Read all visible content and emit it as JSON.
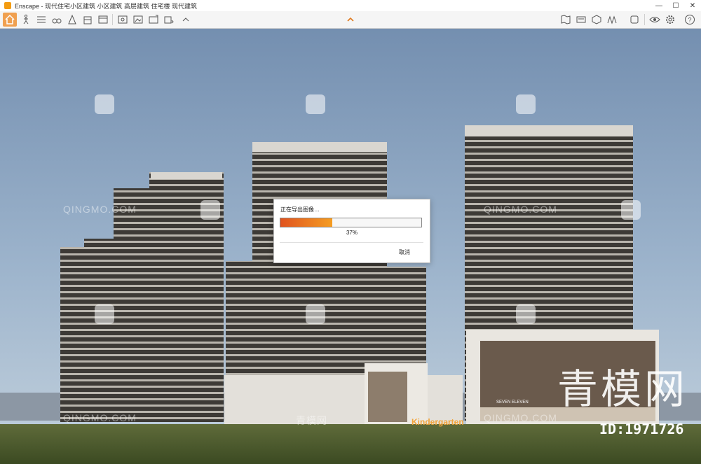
{
  "window": {
    "title": "Enscape - 现代住宅小区建筑 小区建筑 高层建筑 住宅楼 现代建筑",
    "controls": [
      "minimize-icon",
      "maximize-icon",
      "close-icon"
    ]
  },
  "toolbar": {
    "left_icons": [
      "home-icon",
      "walk-icon",
      "sun-settings-icon",
      "binoculars-icon",
      "asset-library-icon",
      "collaboration-icon",
      "views-icon",
      "video-editor-icon",
      "screenshot-icon",
      "batch-render-icon",
      "export-icon",
      "upload-icon"
    ],
    "right_icons": [
      "map-icon",
      "vr-panorama-icon",
      "cube-icon",
      "sketch-icon",
      "render-modes-icon",
      "eye-icon",
      "settings-icon",
      "help-icon"
    ],
    "accent": "#f0a050"
  },
  "dialog": {
    "title": "正在导出图像…",
    "progress": 0.37,
    "percent_label": "37%",
    "cancel_label": "取消",
    "bar_colors": [
      "#e0531f",
      "#f59d22"
    ]
  },
  "scene": {
    "sign_text": "Kindergarten",
    "shop_sign_text": "SEVEN ELEVEN",
    "watermark_text": "QINGMO.COM",
    "watermark_cn": "青模网",
    "brand_text": "青模网",
    "id_text": "ID:1971726"
  }
}
